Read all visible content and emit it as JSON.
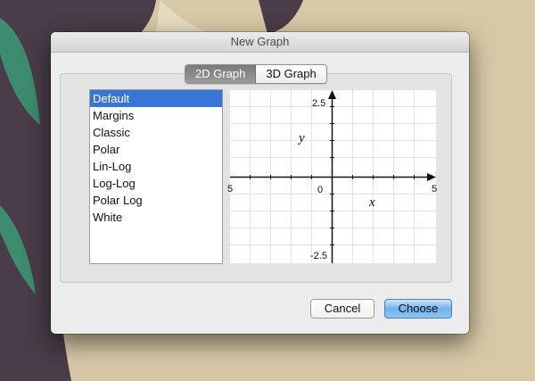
{
  "dialog": {
    "title": "New Graph",
    "tabs": [
      {
        "label": "2D Graph",
        "active": true
      },
      {
        "label": "3D Graph",
        "active": false
      }
    ],
    "templates": [
      "Default",
      "Margins",
      "Classic",
      "Polar",
      "Lin-Log",
      "Log-Log",
      "Polar Log",
      "White"
    ],
    "selected_template": "Default",
    "preview": {
      "y_top": "2.5",
      "y_bottom": "-2.5",
      "x_left": "5",
      "x_right": "5",
      "origin": "0",
      "x_axis_label": "x",
      "y_axis_label": "y"
    },
    "buttons": {
      "cancel": "Cancel",
      "choose": "Choose"
    }
  },
  "colors": {
    "selection": "#3875d7",
    "default_button": "#6fb1ee",
    "desktop_tan": "#d8c9a6",
    "desktop_purple": "#4a3c48"
  }
}
